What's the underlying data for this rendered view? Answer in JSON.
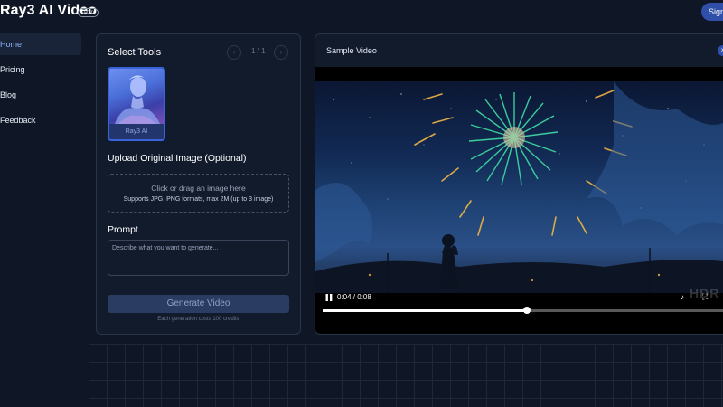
{
  "header": {
    "brand": "Ray3 AI Video",
    "brand_badge": ".com",
    "signin_label": "Sign"
  },
  "nav": {
    "items": [
      {
        "label": "Home",
        "active": true
      },
      {
        "label": "Pricing",
        "active": false
      },
      {
        "label": "Blog",
        "active": false
      },
      {
        "label": "Feedback",
        "active": false
      }
    ]
  },
  "tools": {
    "title": "Select Tools",
    "pager": "1 / 1",
    "prev_icon": "chevron-left-icon",
    "next_icon": "chevron-right-icon",
    "items": [
      {
        "label": "Ray3 AI",
        "selected": true
      }
    ]
  },
  "upload": {
    "title": "Upload Original Image (Optional)",
    "main_text": "Click or drag an image here",
    "sub_text": "Supports JPG, PNG formats, max 2M (up to 3 image)"
  },
  "prompt": {
    "title": "Prompt",
    "placeholder": "Describe what you want to generate..."
  },
  "generate": {
    "button_label": "Generate Video",
    "cost_note": "Each generation costs 100 credits"
  },
  "sample": {
    "title": "Sample Video",
    "close_icon": "close-icon",
    "time": "0:04 / 0:08",
    "progress": 0.5,
    "watermark": "HDR",
    "colors": {
      "accent": "#3b63d9",
      "firework": "#3fd6a0",
      "sparks": "#f2b544"
    }
  }
}
